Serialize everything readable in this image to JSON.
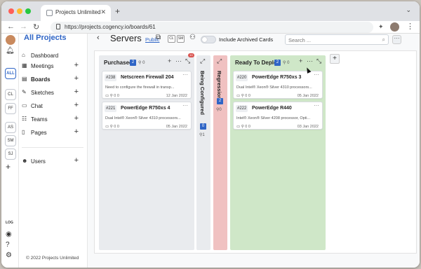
{
  "browser": {
    "tab_title": "Projects Unlimited",
    "url": "https://projects.cogency.io/boards/61",
    "traffic_lights": [
      "#ff5f57",
      "#febc2e",
      "#28c840"
    ]
  },
  "rail": {
    "items": [
      "ALL",
      "CL",
      "FF",
      "AS",
      "SM",
      "SJ"
    ],
    "log_label": "LOG"
  },
  "sidebar": {
    "title": "All Projects",
    "items": [
      {
        "label": "Dashboard",
        "icon": "home-icon"
      },
      {
        "label": "Meetings",
        "icon": "calendar-icon"
      },
      {
        "label": "Boards",
        "icon": "board-icon"
      },
      {
        "label": "Sketches",
        "icon": "sketch-icon"
      },
      {
        "label": "Chat",
        "icon": "chat-icon"
      },
      {
        "label": "Teams",
        "icon": "teams-icon"
      },
      {
        "label": "Pages",
        "icon": "pages-icon"
      },
      {
        "label": "Users",
        "icon": "users-icon"
      }
    ],
    "footer": "© 2022 Projects Unlimited"
  },
  "header": {
    "title": "Servers",
    "public_label": "Public",
    "badges": [
      "CL",
      "SM"
    ],
    "toggle_label": "Include Archived Cards",
    "search_placeholder": "Search ..."
  },
  "columns": [
    {
      "title": "Purchased",
      "count": "2",
      "links": "0",
      "notif": "10",
      "cards": [
        {
          "num": "#238",
          "title": "Netscreen Firewall 204",
          "desc": "Need to configure the firewall in transp...",
          "meta": "0  0",
          "date": "12 Jan 2022"
        },
        {
          "num": "#221",
          "title": "PowerEdge R750xs 4",
          "desc": "Dual Intel® Xeon® Silver 4310 processors...",
          "meta": "0  0",
          "date": "05 Jan 2022"
        }
      ]
    },
    {
      "title": "Being Configured",
      "count": "0",
      "links": "1"
    },
    {
      "title": "Regressions",
      "count": "2",
      "links": "0"
    },
    {
      "title": "Ready To Deploy",
      "count": "2",
      "links": "0",
      "cards": [
        {
          "num": "#220",
          "title": "PowerEdge R750xs 3",
          "desc": "Dual Intel® Xeon® Silver 4310 processors...",
          "meta": "0  0",
          "date": "05 Jan 2022"
        },
        {
          "num": "#222",
          "title": "PowerEdge R440",
          "desc": "Intel® Xeon® Silver 4208 processor, Opti...",
          "meta": "0  0",
          "date": "03 Jan 2022"
        }
      ]
    }
  ],
  "colors": {
    "accent": "#2f65c6",
    "purchased_bg": "#e9ebee",
    "being_configured_bg": "#e9ebee",
    "regressions_bg": "#f0c1c1",
    "ready_bg": "#cfe7c8"
  }
}
